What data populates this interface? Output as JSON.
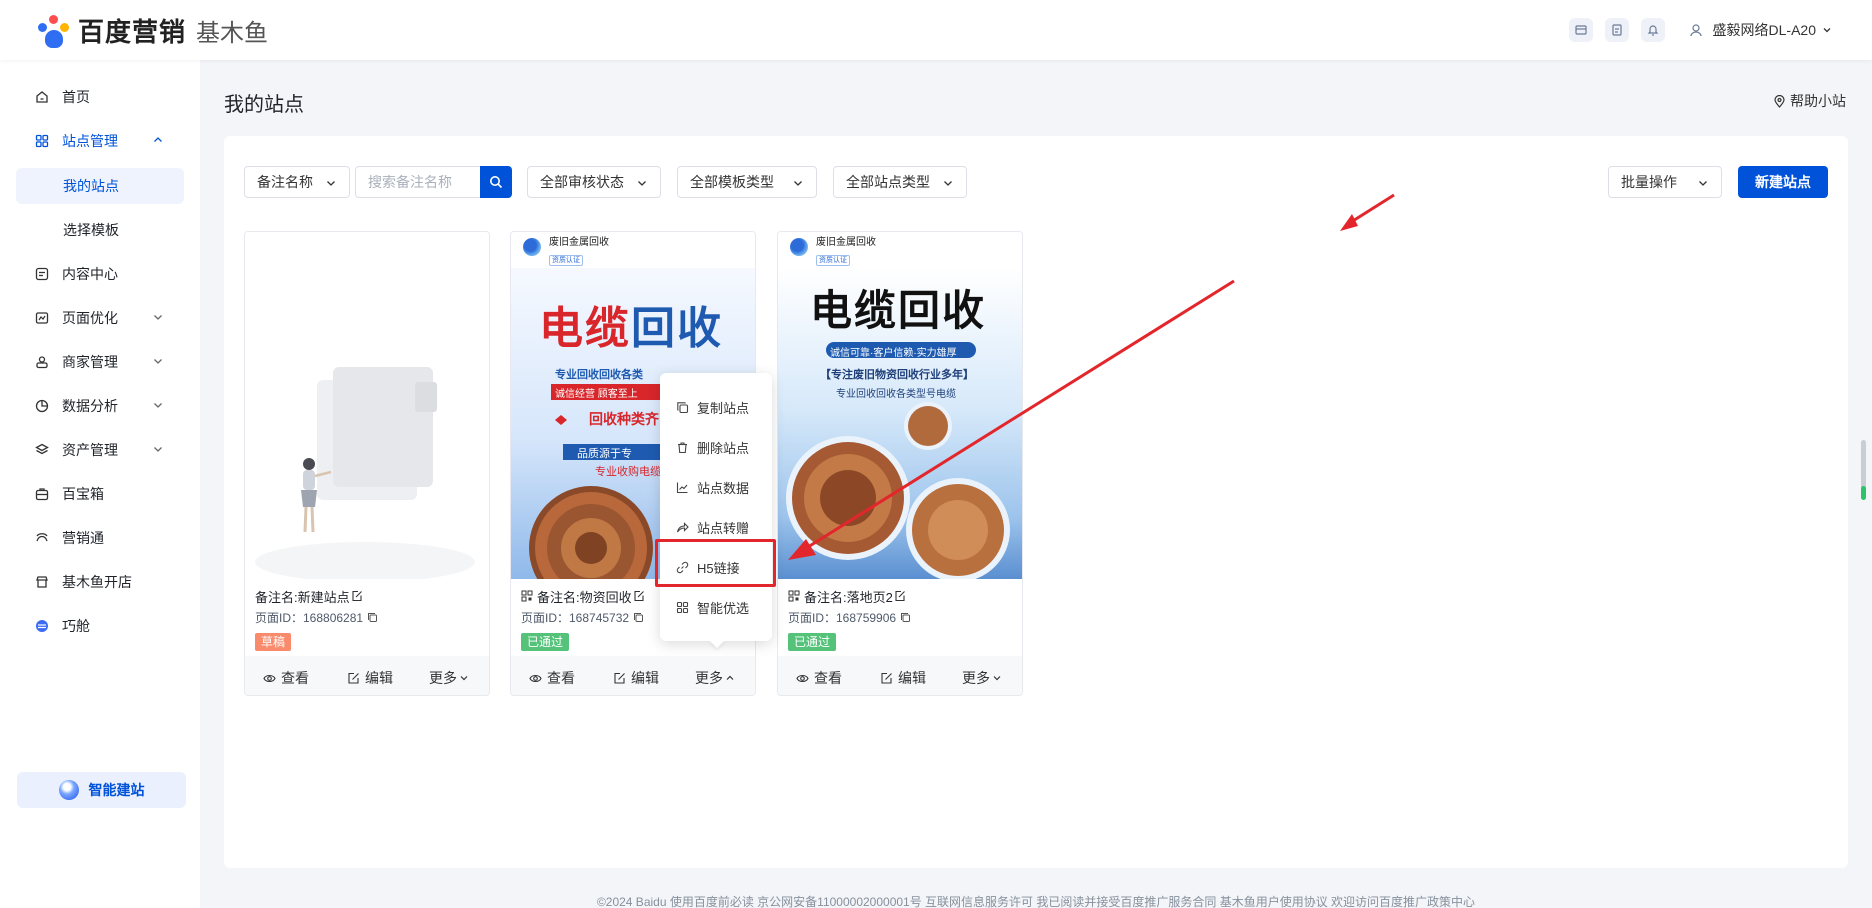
{
  "header": {
    "brand": "百度营销",
    "product": "基木鱼",
    "user": "盛毅网络DL-A20"
  },
  "sidebar": {
    "items": [
      {
        "label": "首页"
      },
      {
        "label": "站点管理"
      },
      {
        "label": "我的站点"
      },
      {
        "label": "选择模板"
      },
      {
        "label": "内容中心"
      },
      {
        "label": "页面优化"
      },
      {
        "label": "商家管理"
      },
      {
        "label": "数据分析"
      },
      {
        "label": "资产管理"
      },
      {
        "label": "百宝箱"
      },
      {
        "label": "营销通"
      },
      {
        "label": "基木鱼开店"
      },
      {
        "label": "巧舱"
      }
    ],
    "ai_button": "智能建站"
  },
  "main": {
    "title": "我的站点",
    "help": "帮助小站",
    "filters": {
      "name_type": "备注名称",
      "search_placeholder": "搜索备注名称",
      "audit_status": "全部审核状态",
      "template_type": "全部模板类型",
      "site_type": "全部站点类型",
      "batch": "批量操作",
      "new_site": "新建站点"
    },
    "cards": [
      {
        "remark": "备注名:新建站点",
        "page_id": "页面ID：168806281",
        "status": "草稿",
        "status_color": "#f98a6b",
        "actions": {
          "view": "查看",
          "edit": "编辑",
          "more": "更多"
        }
      },
      {
        "site_name": "废旧金属回收",
        "site_tag": "资质认证",
        "poster_title_a": "电缆",
        "poster_title_b": "回收",
        "poster_line1": "专业回收回收各类",
        "poster_line2": "诚信经营 顾客至上",
        "poster_line3": "回收种类齐",
        "poster_line4": "品质源于专",
        "poster_line5": "专业收购电缆",
        "remark": "备注名:物资回收",
        "page_id": "页面ID：168745732",
        "status": "已通过",
        "status_color": "#55c27a",
        "actions": {
          "view": "查看",
          "edit": "编辑",
          "more": "更多"
        }
      },
      {
        "site_name": "废旧金属回收",
        "site_tag": "资质认证",
        "poster_title": "电缆回收",
        "poster_line1": "诚信可靠·客户信赖·实力雄厚",
        "poster_line2": "【专注废旧物资回收行业多年】",
        "poster_line3": "专业回收回收各类型号电缆",
        "remark": "备注名:落地页2",
        "page_id": "页面ID：168759906",
        "status": "已通过",
        "status_color": "#55c27a",
        "actions": {
          "view": "查看",
          "edit": "编辑",
          "more": "更多"
        }
      }
    ],
    "menu": [
      {
        "label": "复制站点",
        "icon": "copy-icon"
      },
      {
        "label": "删除站点",
        "icon": "trash-icon"
      },
      {
        "label": "站点数据",
        "icon": "chart-line-icon"
      },
      {
        "label": "站点转赠",
        "icon": "share-icon"
      },
      {
        "label": "H5链接",
        "icon": "link-icon"
      },
      {
        "label": "智能优选",
        "icon": "grid-icon"
      }
    ]
  },
  "footer": "©2024 Baidu 使用百度前必读 京公网安备11000002000001号 互联网信息服务许可 我已阅读并接受百度推广服务合同 基木鱼用户使用协议 欢迎访问百度推广政策中心",
  "colors": {
    "accent": "#0052d9",
    "annotation": "#e3262b"
  }
}
